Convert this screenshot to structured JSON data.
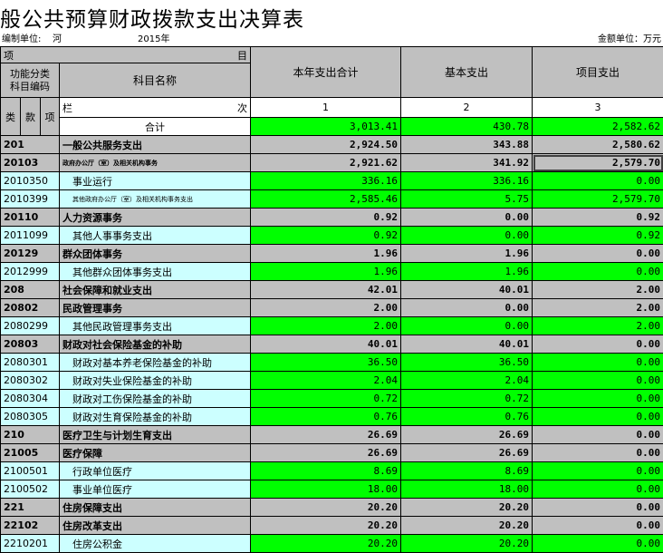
{
  "title": "般公共预算财政拨款支出决算表",
  "meta": {
    "org_label": "编制单位:",
    "org_value": "河",
    "year": "2015年",
    "unit": "金额单位：万元"
  },
  "header": {
    "xiang": "项",
    "mu": "目",
    "func_code": "功能分类\n科目编码",
    "subject_name": "科目名称",
    "col_total": "本年支出合计",
    "col_basic": "基本支出",
    "col_project": "项目支出",
    "lei": "类",
    "kuan": "款",
    "xiang2": "项",
    "lan": "栏",
    "ci": "次",
    "idx1": "1",
    "idx2": "2",
    "idx3": "3"
  },
  "total_row": {
    "name": "合计",
    "total": "3,013.41",
    "basic": "430.78",
    "project": "2,582.62"
  },
  "rows": [
    {
      "code": "201",
      "name": "一般公共服务支出",
      "total": "2,924.50",
      "basic": "343.88",
      "project": "2,580.62",
      "level": "class"
    },
    {
      "code": "20103",
      "name": "政府办公厅（室）及相关机构事务",
      "total": "2,921.62",
      "basic": "341.92",
      "project": "2,579.70",
      "level": "kuan-small"
    },
    {
      "code": "2010350",
      "name": "事业运行",
      "total": "336.16",
      "basic": "336.16",
      "project": "0.00",
      "level": "item"
    },
    {
      "code": "2010399",
      "name": "其他政府办公厅（室）及相关机构事务支出",
      "total": "2,585.46",
      "basic": "5.75",
      "project": "2,579.70",
      "level": "item-small"
    },
    {
      "code": "20110",
      "name": "人力资源事务",
      "total": "0.92",
      "basic": "0.00",
      "project": "0.92",
      "level": "kuan"
    },
    {
      "code": "2011099",
      "name": "其他人事事务支出",
      "total": "0.92",
      "basic": "0.00",
      "project": "0.92",
      "level": "item"
    },
    {
      "code": "20129",
      "name": "群众团体事务",
      "total": "1.96",
      "basic": "1.96",
      "project": "0.00",
      "level": "kuan"
    },
    {
      "code": "2012999",
      "name": "其他群众团体事务支出",
      "total": "1.96",
      "basic": "1.96",
      "project": "0.00",
      "level": "item"
    },
    {
      "code": "208",
      "name": "社会保障和就业支出",
      "total": "42.01",
      "basic": "40.01",
      "project": "2.00",
      "level": "class"
    },
    {
      "code": "20802",
      "name": "民政管理事务",
      "total": "2.00",
      "basic": "0.00",
      "project": "2.00",
      "level": "kuan"
    },
    {
      "code": "2080299",
      "name": "其他民政管理事务支出",
      "total": "2.00",
      "basic": "0.00",
      "project": "2.00",
      "level": "item"
    },
    {
      "code": "20803",
      "name": "财政对社会保险基金的补助",
      "total": "40.01",
      "basic": "40.01",
      "project": "0.00",
      "level": "kuan"
    },
    {
      "code": "2080301",
      "name": "财政对基本养老保险基金的补助",
      "total": "36.50",
      "basic": "36.50",
      "project": "0.00",
      "level": "item"
    },
    {
      "code": "2080302",
      "name": "财政对失业保险基金的补助",
      "total": "2.04",
      "basic": "2.04",
      "project": "0.00",
      "level": "item"
    },
    {
      "code": "2080304",
      "name": "财政对工伤保险基金的补助",
      "total": "0.72",
      "basic": "0.72",
      "project": "0.00",
      "level": "item"
    },
    {
      "code": "2080305",
      "name": "财政对生育保险基金的补助",
      "total": "0.76",
      "basic": "0.76",
      "project": "0.00",
      "level": "item"
    },
    {
      "code": "210",
      "name": "医疗卫生与计划生育支出",
      "total": "26.69",
      "basic": "26.69",
      "project": "0.00",
      "level": "class"
    },
    {
      "code": "21005",
      "name": "医疗保障",
      "total": "26.69",
      "basic": "26.69",
      "project": "0.00",
      "level": "kuan"
    },
    {
      "code": "2100501",
      "name": "行政单位医疗",
      "total": "8.69",
      "basic": "8.69",
      "project": "0.00",
      "level": "item"
    },
    {
      "code": "2100502",
      "name": "事业单位医疗",
      "total": "18.00",
      "basic": "18.00",
      "project": "0.00",
      "level": "item"
    },
    {
      "code": "221",
      "name": "住房保障支出",
      "total": "20.20",
      "basic": "20.20",
      "project": "0.00",
      "level": "class"
    },
    {
      "code": "22102",
      "name": "住房改革支出",
      "total": "20.20",
      "basic": "20.20",
      "project": "0.00",
      "level": "kuan"
    },
    {
      "code": "2210201",
      "name": "住房公积金",
      "total": "20.20",
      "basic": "20.20",
      "project": "0.00",
      "level": "item"
    }
  ],
  "colors": {
    "header_grey": "#c0c0c0",
    "data_green": "#00ff00",
    "item_cyan": "#ccffff"
  }
}
